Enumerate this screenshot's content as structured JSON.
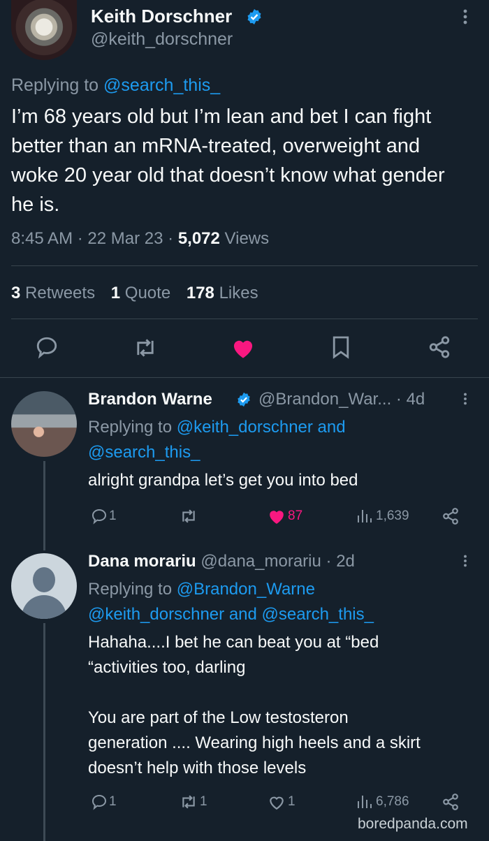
{
  "main_tweet": {
    "author_name": "Keith Dorschner",
    "author_handle": "@keith_dorschner",
    "replying_prefix": "Replying to",
    "replying_to": "@search_this_",
    "text": "I’m 68 years old but I’m lean and bet I can fight better than an mRNA-treated, overweight and woke 20 year old that doesn’t know what gender he is.",
    "time": "8:45 AM",
    "date": "22 Mar 23",
    "views_count": "5,072",
    "views_label": "Views",
    "retweets_count": "3",
    "retweets_label": "Retweets",
    "quotes_count": "1",
    "quotes_label": "Quote",
    "likes_count": "178",
    "likes_label": "Likes"
  },
  "replies": [
    {
      "author_name": "Brandon Warne",
      "author_handle": "@Brandon_War...",
      "age": "4d",
      "replying_prefix": "Replying to",
      "replying_line1": "@keith_dorschner and",
      "replying_line2": "@search_this_",
      "text": "alright grandpa let’s get you into bed",
      "reply_count": "1",
      "retweet_count": "",
      "like_count": "87",
      "view_count": "1,639"
    },
    {
      "author_name": "Dana morariu",
      "author_handle": "@dana_morariu",
      "age": "2d",
      "replying_prefix": "Replying to",
      "replying_line1_mention": "@Brandon_Warne",
      "replying_line2_a": "@keith_dorschner",
      "replying_line2_and": "and",
      "replying_line2_b": "@search_this_",
      "text_line1": "Hahaha....I bet he can beat you at “bed",
      "text_line2": "“activities  too, darling",
      "text_line3": "You are part of the Low testosteron",
      "text_line4": "generation .... Wearing high heels and a skirt",
      "text_line5": "doesn’t help with those levels",
      "reply_count": "1",
      "retweet_count": "1",
      "like_count": "1",
      "view_count": "6,786"
    }
  ],
  "watermark": "boredpanda.com",
  "colors": {
    "background": "#15202b",
    "accent_blue": "#1d9bf0",
    "like_pink": "#f91880",
    "muted_text": "#8b98a5",
    "divider": "#38444d"
  },
  "icons": [
    "verified-badge-icon",
    "more-options-icon",
    "reply-icon",
    "retweet-icon",
    "like-icon",
    "bookmark-icon",
    "share-icon",
    "views-icon"
  ]
}
